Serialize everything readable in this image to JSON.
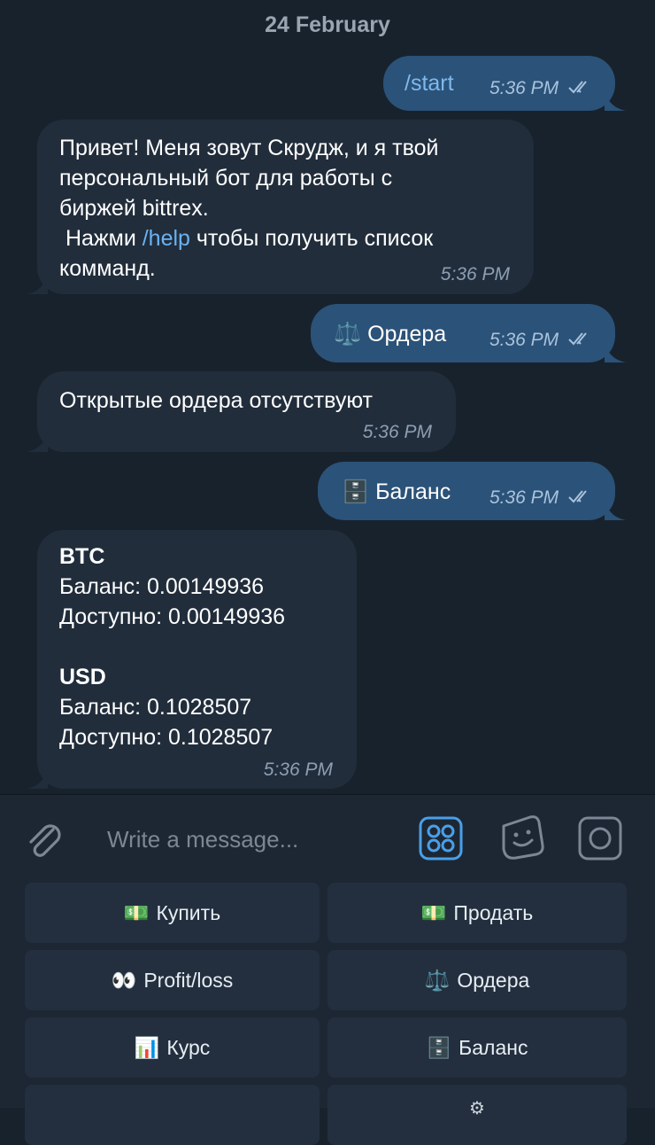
{
  "date_header": "24 February",
  "messages": [
    {
      "dir": "out",
      "text": "/start",
      "time": "5:36 PM"
    },
    {
      "dir": "in",
      "lines": [
        "Привет! Меня зовут Скрудж, и я твой",
        "персональный бот для работы с",
        "биржей bittrex."
      ],
      "line4_pre": " Нажми ",
      "line4_link": "/help",
      "line4_post": " чтобы получить список",
      "line5": "комманд.",
      "time": "5:36 PM"
    },
    {
      "dir": "out",
      "emoji": "⚖️",
      "text": "Ордера",
      "time": "5:36 PM"
    },
    {
      "dir": "in",
      "text": "Открытые ордера отсутствуют",
      "time": "5:36 PM"
    },
    {
      "dir": "out",
      "emoji": "🗄️",
      "text": "Баланс",
      "time": "5:36 PM"
    },
    {
      "dir": "in",
      "btc_title": "BTC",
      "btc_balance": "Баланс: 0.00149936",
      "btc_available": "Доступно: 0.00149936",
      "usd_title": "USD",
      "usd_balance": "Баланс: 0.1028507",
      "usd_available": "Доступно: 0.1028507",
      "time": "5:36 PM"
    }
  ],
  "composer": {
    "placeholder": "Write a message..."
  },
  "keyboard": [
    {
      "emoji": "💵",
      "label": "Купить"
    },
    {
      "emoji": "💵",
      "label": "Продать"
    },
    {
      "emoji": "👀",
      "label": "Profit/loss"
    },
    {
      "emoji": "⚖️",
      "label": "Ордера"
    },
    {
      "emoji": "📊",
      "label": "Курс"
    },
    {
      "emoji": "🗄️",
      "label": "Баланс"
    }
  ],
  "colors": {
    "bg": "#18222d",
    "outgoing": "#2b5278",
    "incoming": "#212d3b",
    "link": "#6ab3f3",
    "accent": "#4a9fe8"
  }
}
